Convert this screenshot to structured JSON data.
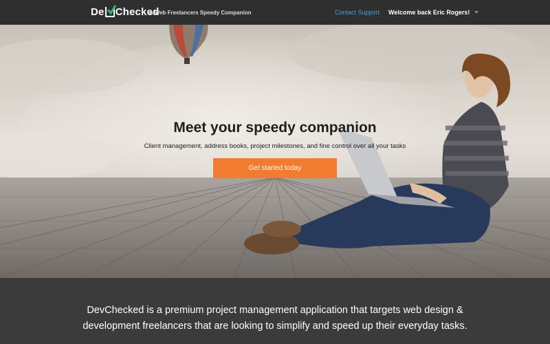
{
  "navbar": {
    "logo_text": "DevChecked",
    "logo_part1": "De",
    "logo_part2": "Checked",
    "tagline": "A Web Freelancers Speedy Companion",
    "contact_link": "Contact Support",
    "user_greeting": "Welcome back Eric Rogers!"
  },
  "hero": {
    "title": "Meet your speedy companion",
    "subtitle": "Client management, address books, project milestones, and fine control over all your tasks",
    "cta_label": "Get started today"
  },
  "about": {
    "line1": "DevChecked is a premium project management application that targets web design &",
    "line2": "development freelancers that are looking to simplify and speed up their everyday tasks."
  },
  "colors": {
    "navbar_bg": "#2f2f2f",
    "accent_link": "#3aa3e3",
    "cta_bg": "#f17b2f",
    "footer_bg": "#3b3b3b"
  },
  "icons": {
    "logo_check": "checkmark-icon",
    "user_menu_caret": "caret-down-icon"
  }
}
